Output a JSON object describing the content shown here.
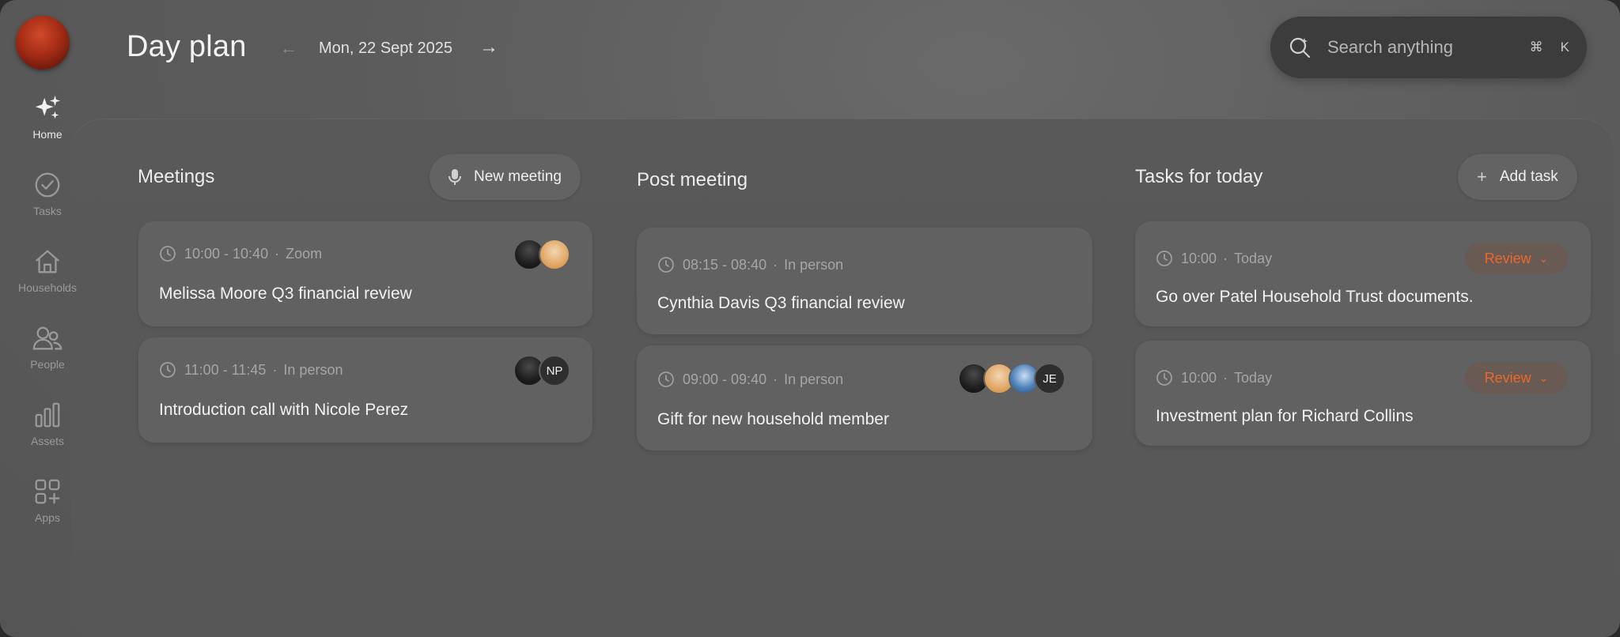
{
  "header": {
    "title": "Day plan",
    "date": "Mon, 22 Sept 2025",
    "prev_icon": "arrow-left-icon",
    "next_icon": "arrow-right-icon"
  },
  "search": {
    "placeholder": "Search anything",
    "shortcut_cmd": "⌘",
    "shortcut_key": "K"
  },
  "sidebar": {
    "items": [
      {
        "label": "Home",
        "icon": "sparkles-icon",
        "active": true
      },
      {
        "label": "Tasks",
        "icon": "check-circle-icon"
      },
      {
        "label": "Households",
        "icon": "house-icon"
      },
      {
        "label": "People",
        "icon": "people-icon"
      },
      {
        "label": "Assets",
        "icon": "bar-chart-icon"
      },
      {
        "label": "Apps",
        "icon": "apps-grid-icon"
      }
    ]
  },
  "meetings": {
    "title": "Meetings",
    "new_button": "New meeting",
    "items": [
      {
        "time": "10:00 - 10:40",
        "location": "Zoom",
        "title": "Melissa Moore Q3 financial review"
      },
      {
        "time": "11:00 - 11:45",
        "location": "In person",
        "title": "Introduction call with Nicole Perez",
        "initials": "NP"
      }
    ]
  },
  "post_meeting": {
    "title": "Post meeting",
    "items": [
      {
        "time": "08:15 - 08:40",
        "location": "In person",
        "title": "Cynthia Davis Q3 financial review"
      },
      {
        "time": "09:00 - 09:40",
        "location": "In person",
        "title": "Gift for new household member",
        "initials": "JE"
      }
    ]
  },
  "tasks": {
    "title": "Tasks for today",
    "add_button": "Add task",
    "items": [
      {
        "time": "10:00",
        "day": "Today",
        "title": "Go over Patel Household Trust documents.",
        "action": "Review"
      },
      {
        "time": "10:00",
        "day": "Today",
        "title": "Investment plan for Richard Collins",
        "action": "Review"
      }
    ]
  },
  "colors": {
    "accent_orange": "#e86a2a",
    "background": "#5b5b5b",
    "card": "#616161"
  }
}
